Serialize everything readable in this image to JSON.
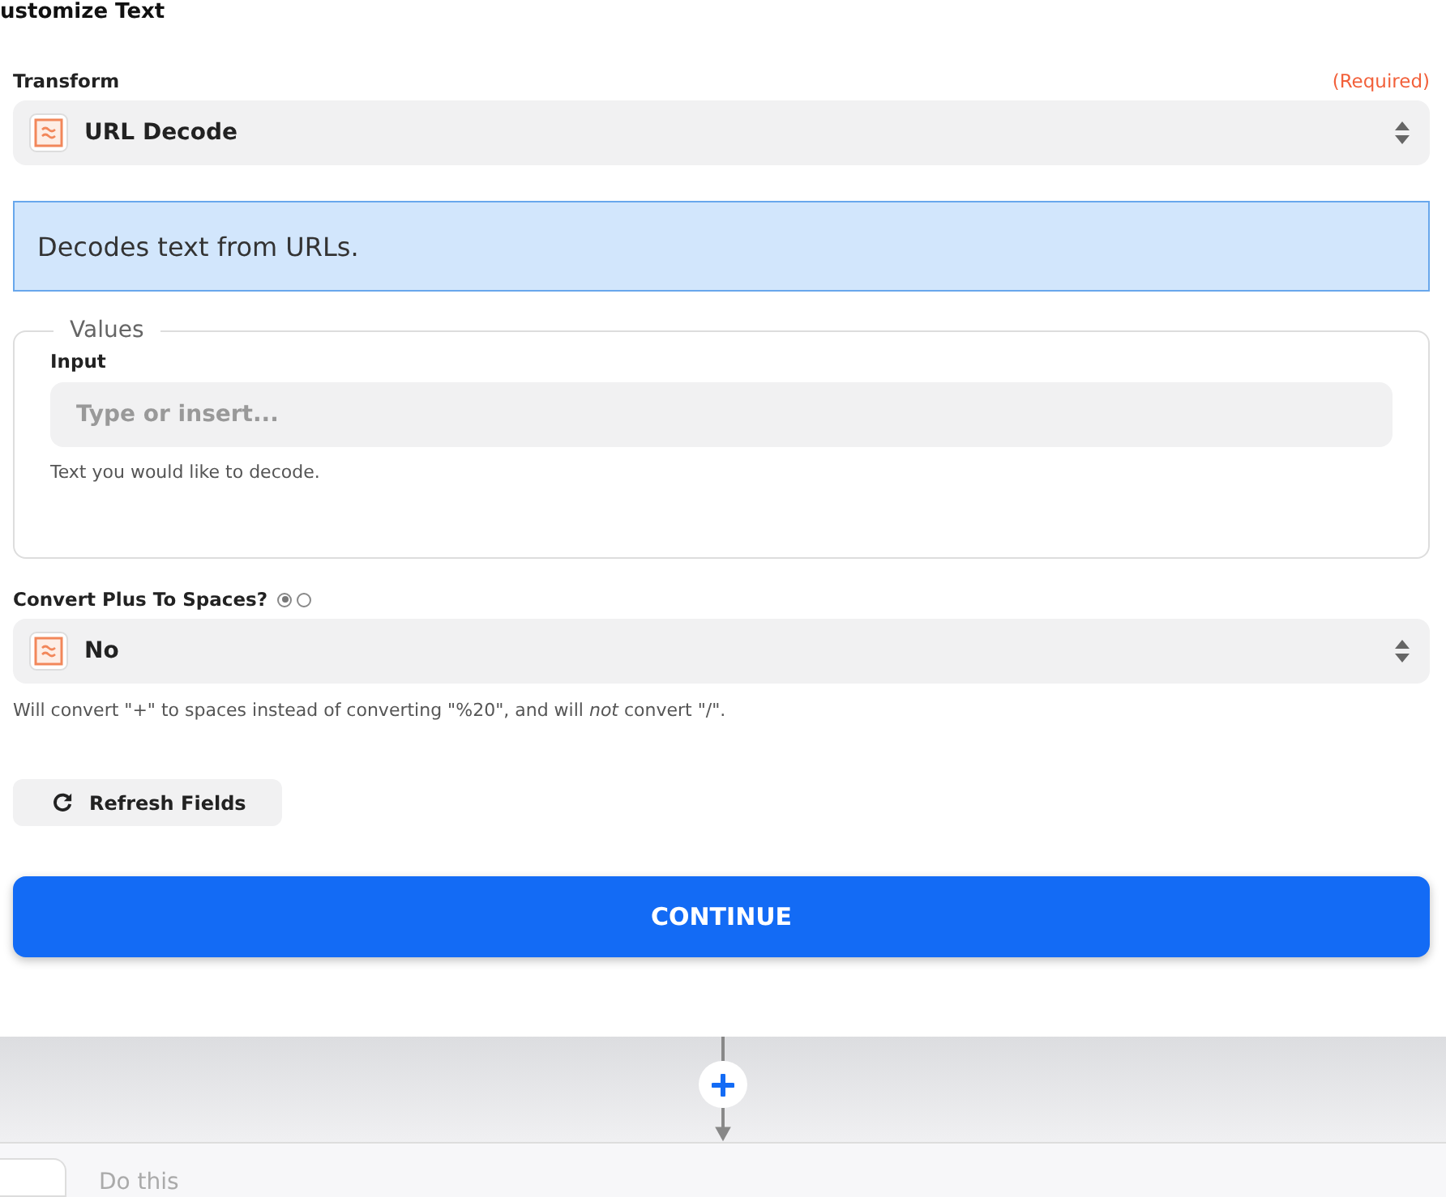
{
  "header": {
    "title": "ustomize Text"
  },
  "transform": {
    "label": "Transform",
    "required": "(Required)",
    "value": "URL Decode"
  },
  "description": "Decodes text from URLs.",
  "values": {
    "legend": "Values",
    "input": {
      "label": "Input",
      "placeholder": "Type or insert...",
      "help": "Text you would like to decode."
    }
  },
  "convert": {
    "label": "Convert Plus To Spaces?",
    "options": [
      {
        "selected": true
      },
      {
        "selected": false
      }
    ],
    "value": "No",
    "help": "Will convert \"+\" to spaces instead of converting \"%20\", and will *not* convert \"/\"."
  },
  "refresh_button": "Refresh Fields",
  "continue_button": "CONTINUE",
  "next_step": {
    "label": "Do this"
  }
}
